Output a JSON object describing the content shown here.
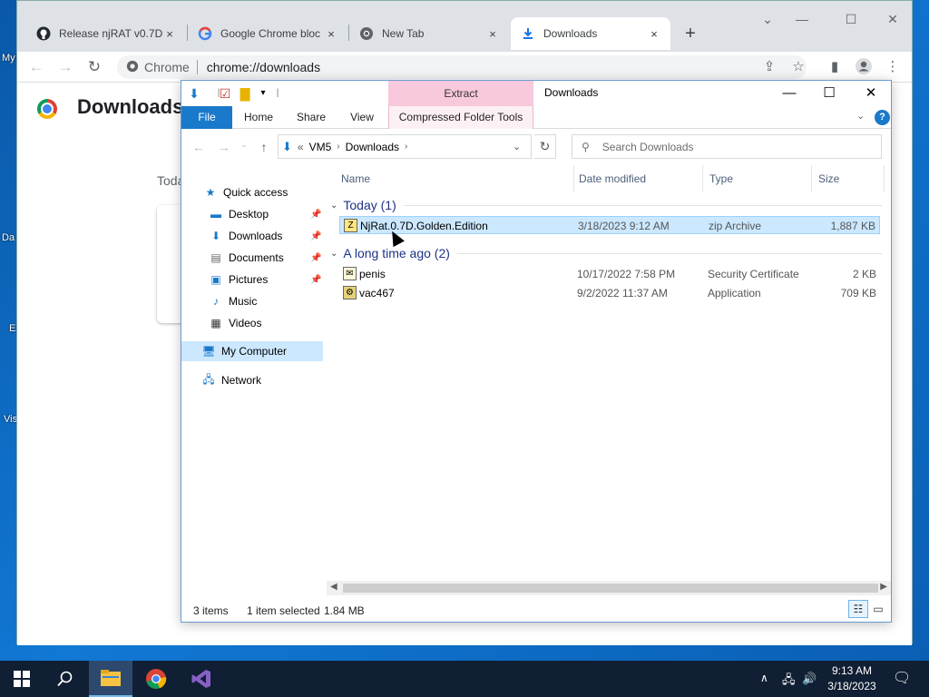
{
  "desktop": {
    "labels": [
      "My",
      "Da",
      "E",
      "Vis"
    ]
  },
  "chrome": {
    "tabs": [
      {
        "title": "Release njRAT v0.7D",
        "close": "×"
      },
      {
        "title": "Google Chrome bloc",
        "close": "×"
      },
      {
        "title": "New Tab",
        "close": "×"
      },
      {
        "title": "Downloads",
        "close": "×"
      }
    ],
    "new_tab": "+",
    "omnibox": {
      "chip": "Chrome",
      "url": "chrome://downloads"
    },
    "page": {
      "title": "Downloads",
      "today": "Toda"
    }
  },
  "explorer": {
    "title": "Downloads",
    "context_tab": "Extract",
    "ribbon_tabs": {
      "file": "File",
      "home": "Home",
      "share": "Share",
      "view": "View",
      "context": "Compressed Folder Tools"
    },
    "address": {
      "prefix": "«",
      "parts": [
        "VM5",
        "Downloads"
      ]
    },
    "search_placeholder": "Search Downloads",
    "nav": {
      "quick_access": "Quick access",
      "desktop": "Desktop",
      "downloads": "Downloads",
      "documents": "Documents",
      "pictures": "Pictures",
      "music": "Music",
      "videos": "Videos",
      "my_computer": "My Computer",
      "network": "Network"
    },
    "columns": {
      "name": "Name",
      "date": "Date modified",
      "type": "Type",
      "size": "Size"
    },
    "groups": [
      {
        "label": "Today (1)"
      },
      {
        "label": "A long time ago (2)"
      }
    ],
    "files": [
      {
        "name": "NjRat.0.7D.Golden.Edition",
        "date": "3/18/2023 9:12 AM",
        "type": "zip Archive",
        "size": "1,887 KB"
      },
      {
        "name": "penis",
        "date": "10/17/2022 7:58 PM",
        "type": "Security Certificate",
        "size": "2 KB"
      },
      {
        "name": "vac467",
        "date": "9/2/2022 11:37 AM",
        "type": "Application",
        "size": "709 KB"
      }
    ],
    "status": {
      "items": "3 items",
      "selected": "1 item selected",
      "size": "1.84 MB"
    }
  },
  "taskbar": {
    "time": "9:13 AM",
    "date": "3/18/2023"
  }
}
